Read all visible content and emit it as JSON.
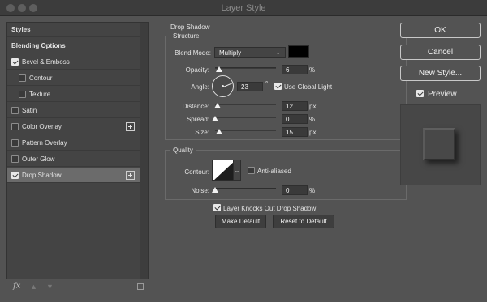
{
  "window": {
    "title": "Layer Style"
  },
  "sidebar": {
    "items": [
      {
        "label": "Styles",
        "checkbox": false,
        "checked": false,
        "plus": false,
        "bold": true,
        "active": false
      },
      {
        "label": "Blending Options",
        "checkbox": false,
        "checked": false,
        "plus": false,
        "bold": true,
        "active": false
      },
      {
        "label": "Bevel & Emboss",
        "checkbox": true,
        "checked": true,
        "plus": false,
        "bold": false,
        "active": false
      },
      {
        "label": "Contour",
        "checkbox": true,
        "checked": false,
        "plus": false,
        "bold": false,
        "active": false,
        "sub": true
      },
      {
        "label": "Texture",
        "checkbox": true,
        "checked": false,
        "plus": false,
        "bold": false,
        "active": false,
        "sub": true
      },
      {
        "label": "Satin",
        "checkbox": true,
        "checked": false,
        "plus": false,
        "bold": false,
        "active": false
      },
      {
        "label": "Color Overlay",
        "checkbox": true,
        "checked": false,
        "plus": true,
        "bold": false,
        "active": false
      },
      {
        "label": "Pattern Overlay",
        "checkbox": true,
        "checked": false,
        "plus": false,
        "bold": false,
        "active": false
      },
      {
        "label": "Outer Glow",
        "checkbox": true,
        "checked": false,
        "plus": false,
        "bold": false,
        "active": false
      },
      {
        "label": "Drop Shadow",
        "checkbox": true,
        "checked": true,
        "plus": true,
        "bold": false,
        "active": true
      }
    ],
    "footer": {
      "fx_label": "fx"
    }
  },
  "drop_shadow": {
    "section_title": "Drop Shadow",
    "structure": {
      "title": "Structure",
      "blend_mode": {
        "label": "Blend Mode:",
        "value": "Multiply"
      },
      "shadow_color": "#000000",
      "opacity": {
        "label": "Opacity:",
        "value": "6",
        "unit": "%",
        "fraction": 0.06
      },
      "angle": {
        "label": "Angle:",
        "value": "23",
        "unit": "°",
        "use_global_light_label": "Use Global Light",
        "use_global_light": true
      },
      "distance": {
        "label": "Distance:",
        "value": "12",
        "unit": "px",
        "fraction": 0.04
      },
      "spread": {
        "label": "Spread:",
        "value": "0",
        "unit": "%",
        "fraction": 0.0
      },
      "size": {
        "label": "Size:",
        "value": "15",
        "unit": "px",
        "fraction": 0.06
      }
    },
    "quality": {
      "title": "Quality",
      "contour_label": "Contour:",
      "anti_aliased_label": "Anti-aliased",
      "anti_aliased": false,
      "noise": {
        "label": "Noise:",
        "value": "0",
        "unit": "%",
        "fraction": 0.0
      }
    },
    "knockout_label": "Layer Knocks Out Drop Shadow",
    "knockout": true,
    "make_default_label": "Make Default",
    "reset_default_label": "Reset to Default"
  },
  "actions": {
    "ok_label": "OK",
    "cancel_label": "Cancel",
    "new_style_label": "New Style...",
    "preview_label": "Preview",
    "preview_checked": true
  }
}
